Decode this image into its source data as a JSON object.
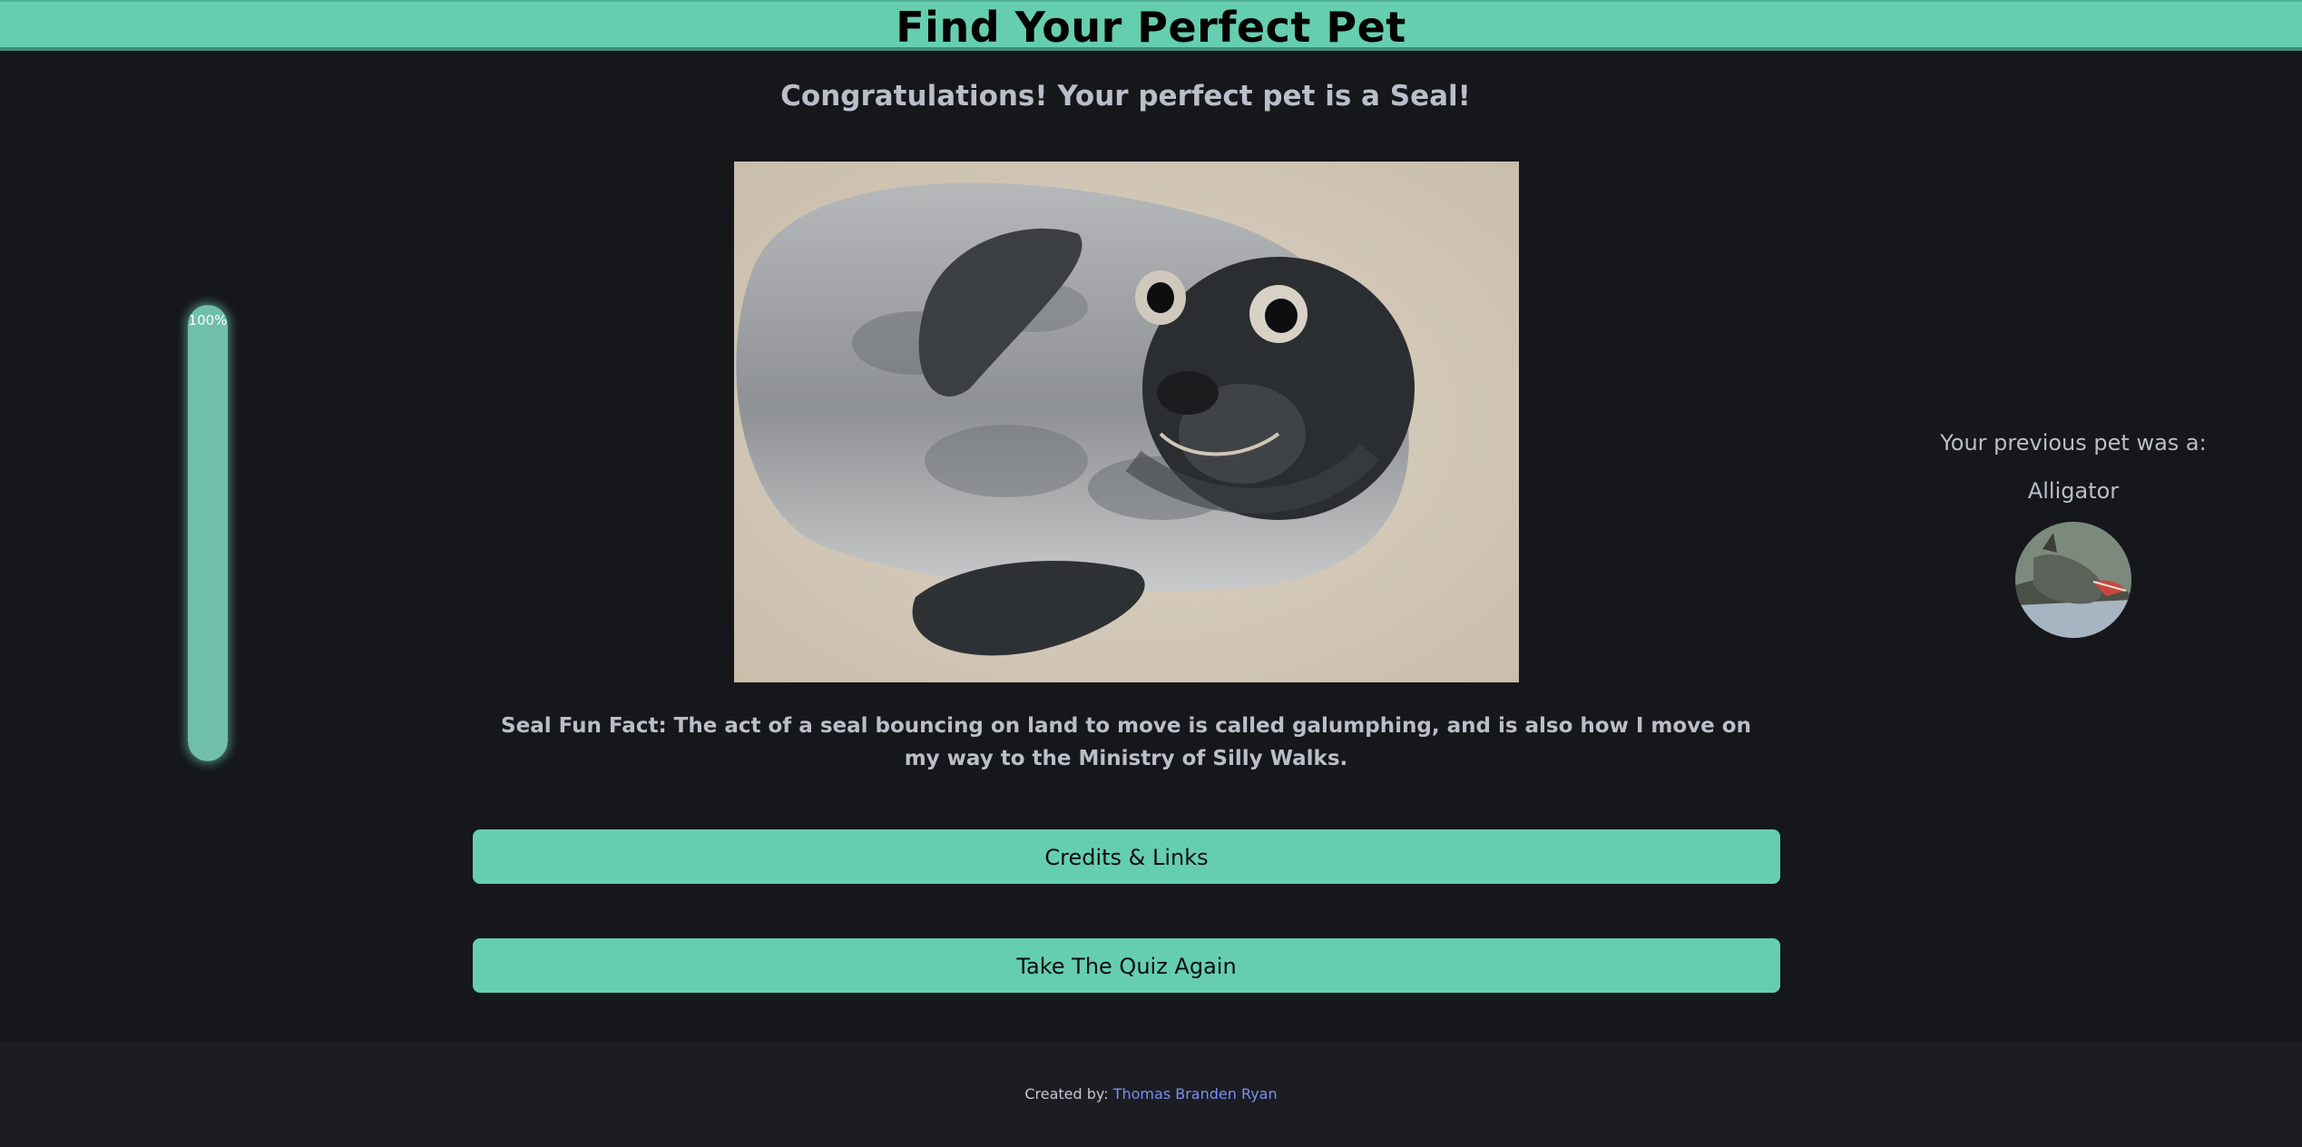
{
  "header": {
    "title": "Find Your Perfect Pet"
  },
  "result": {
    "title": "Congratulations! Your perfect pet is a Seal!",
    "pet": "Seal",
    "image_alt": "Seal",
    "fun_fact": "Seal Fun Fact: The act of a seal bouncing on land to move is called galumphing, and is also how I move on my way to the Ministry of Silly Walks."
  },
  "progress": {
    "label": "100%",
    "value": 1.0,
    "color": "#6fbfaa"
  },
  "buttons": {
    "credits_label": "Credits & Links",
    "retake_label": "Take The Quiz Again"
  },
  "previous": {
    "label": "Your previous pet was a:",
    "name": "Alligator",
    "image_alt": "Alligator"
  },
  "footer": {
    "prefix": "Created by:",
    "author": "Thomas Branden Ryan"
  },
  "colors": {
    "accent": "#66ceb0",
    "background": "#15171b",
    "text": "#b9bec9",
    "link": "#7c8cf3"
  }
}
